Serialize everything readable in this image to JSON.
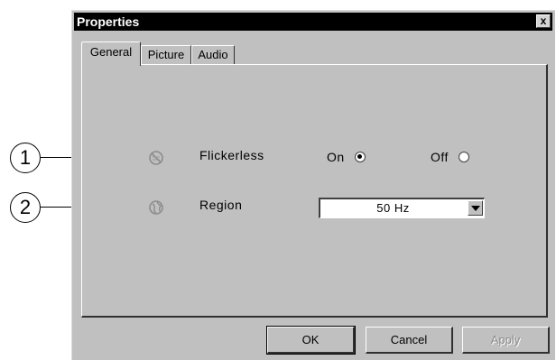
{
  "window": {
    "title": "Properties",
    "close_glyph": "x"
  },
  "tabs": [
    {
      "label": "General",
      "active": true
    },
    {
      "label": "Picture",
      "active": false
    },
    {
      "label": "Audio",
      "active": false
    }
  ],
  "callouts": [
    "1",
    "2"
  ],
  "flickerless": {
    "label": "Flickerless",
    "icon": "flicker-icon",
    "on_label": "On",
    "off_label": "Off",
    "selected": "On"
  },
  "region": {
    "label": "Region",
    "icon": "globe-icon",
    "value": "50 Hz"
  },
  "buttons": {
    "ok": "OK",
    "cancel": "Cancel",
    "apply": "Apply"
  }
}
